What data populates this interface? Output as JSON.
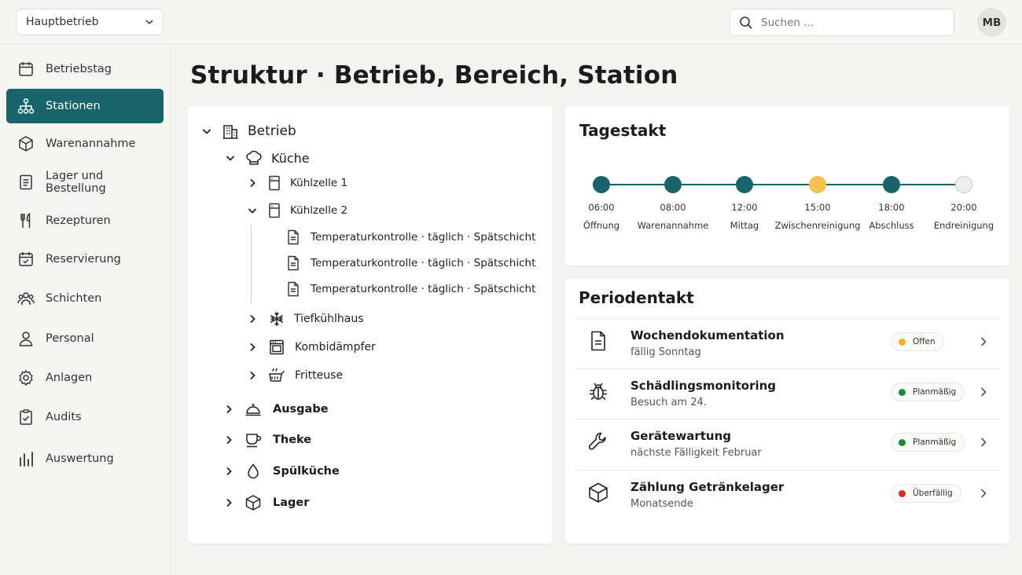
{
  "header": {
    "site_select": "Hauptbetrieb",
    "search_placeholder": "Suchen ...",
    "avatar_initials": "MB"
  },
  "sidebar": {
    "items": [
      {
        "label": "Betriebstag",
        "icon": "calendar-icon",
        "active": false
      },
      {
        "label": "Stationen",
        "icon": "hierarchy-icon",
        "active": true
      },
      {
        "label": "Warenannahme",
        "icon": "package-icon",
        "active": false
      },
      {
        "label": "Lager und Bestellung",
        "icon": "document-icon",
        "active": false
      },
      {
        "label": "Rezepturen",
        "icon": "utensils-icon",
        "active": false
      },
      {
        "label": "Reservierung",
        "icon": "calendar-check-icon",
        "active": false
      },
      {
        "label": "Schichten",
        "icon": "users-icon",
        "active": false
      },
      {
        "label": "Personal",
        "icon": "person-icon",
        "active": false
      },
      {
        "label": "Anlagen",
        "icon": "gear-icon",
        "active": false
      },
      {
        "label": "Audits",
        "icon": "clipboard-check-icon",
        "active": false
      },
      {
        "label": "Auswertung",
        "icon": "bar-chart-icon",
        "active": false
      }
    ]
  },
  "page": {
    "title": "Struktur · Betrieb, Bereich, Station"
  },
  "tree": {
    "root": "Betrieb",
    "kueche": "Küche",
    "kuehlzelle1": "Kühlzelle 1",
    "kuehlzelle2": "Kühlzelle 2",
    "checks": [
      "Temperaturkontrolle · täglich · Spätschicht",
      "Temperaturkontrolle · täglich · Spätschicht",
      "Temperaturkontrolle · täglich · Spätschicht"
    ],
    "stations": [
      "Tiefkühlhaus",
      "Kombidämpfer",
      "Fritteuse"
    ],
    "areas": [
      "Ausgabe",
      "Theke",
      "Spülküche",
      "Lager"
    ]
  },
  "tagestakt": {
    "title": "Tagestakt",
    "steps": [
      {
        "time": "06:00",
        "name": "Öffnung",
        "color": "#17656b"
      },
      {
        "time": "08:00",
        "name": "Warenannahme",
        "color": "#17656b"
      },
      {
        "time": "12:00",
        "name": "Mittag",
        "color": "#17656b"
      },
      {
        "time": "15:00",
        "name": "Zwischenreinigung",
        "color": "#f2c14e"
      },
      {
        "time": "18:00",
        "name": "Abschluss",
        "color": "#17656b"
      },
      {
        "time": "20:00",
        "name": "Endreinigung",
        "color": "#eeeeec"
      }
    ]
  },
  "periodentakt": {
    "title": "Periodentakt",
    "items": [
      {
        "title": "Wochendokumentation",
        "sub": "fällig Sonntag",
        "status": "Offen",
        "status_color": "#f2b01e",
        "icon": "document-icon"
      },
      {
        "title": "Schädlingsmonitoring",
        "sub": "Besuch am 24.",
        "status": "Planmäßig",
        "status_color": "#1e8a3c",
        "icon": "bug-icon"
      },
      {
        "title": "Gerätewartung",
        "sub": "nächste Fälligkeit Februar",
        "status": "Planmäßig",
        "status_color": "#1e8a3c",
        "icon": "wrench-icon"
      },
      {
        "title": "Zählung Getränkelager",
        "sub": "Monatsende",
        "status": "Überfällig",
        "status_color": "#d93025",
        "icon": "box-icon"
      }
    ]
  }
}
